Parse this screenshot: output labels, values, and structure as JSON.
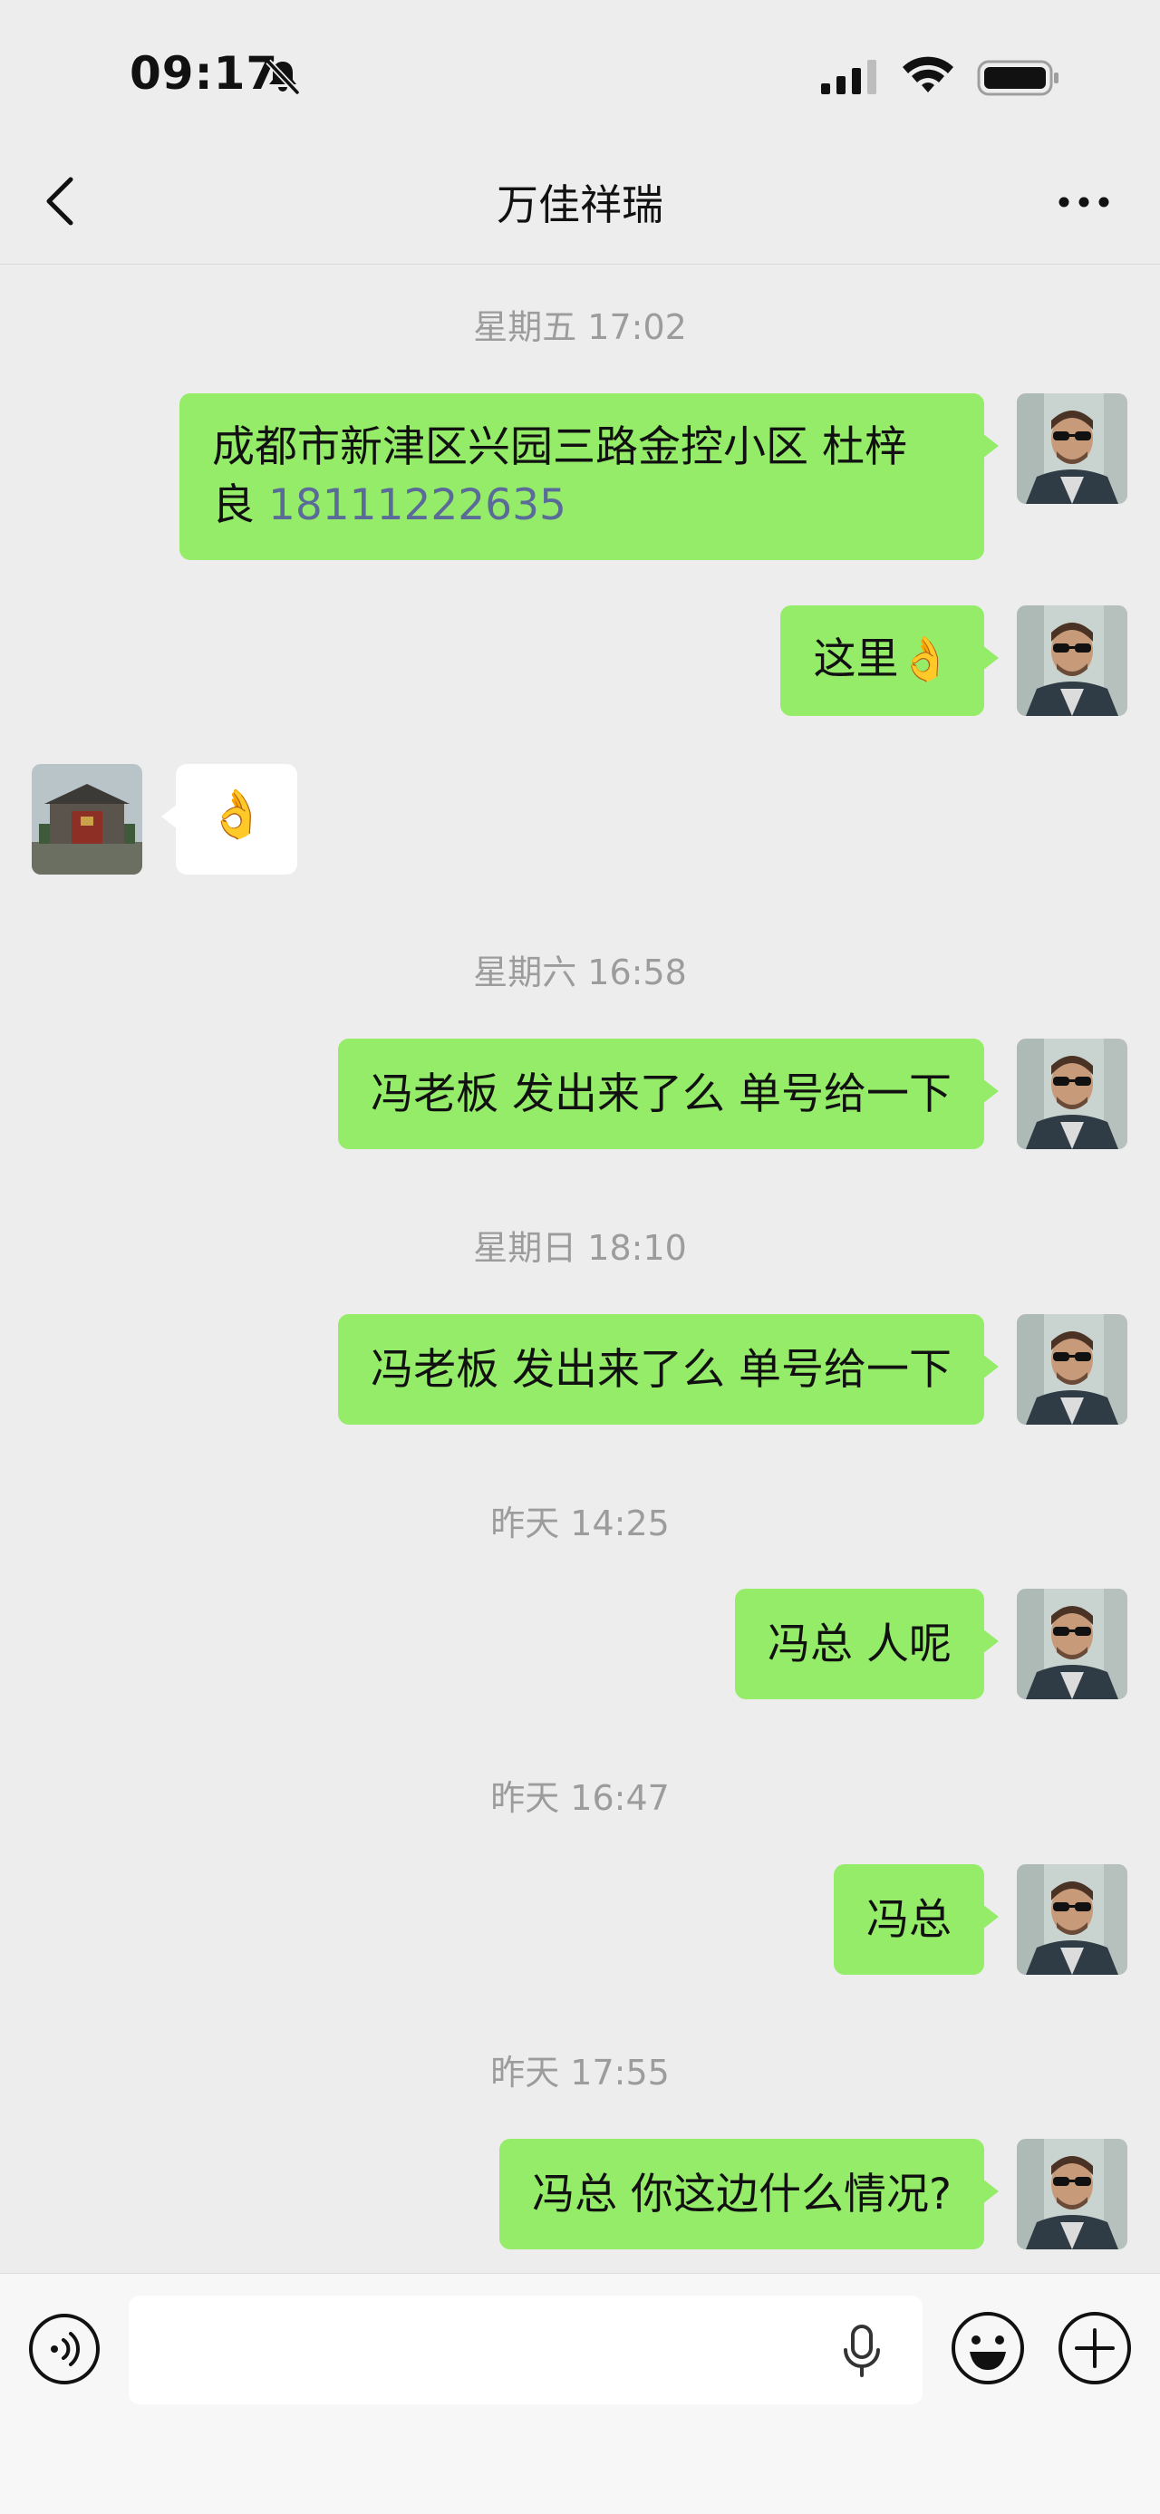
{
  "status_bar": {
    "time": "09:17"
  },
  "nav": {
    "title": "万佳祥瑞"
  },
  "timestamps": [
    "星期五 17:02",
    "星期六 16:58",
    "星期日 18:10",
    "昨天 14:25",
    "昨天 16:47",
    "昨天 17:55"
  ],
  "messages": [
    {
      "sender": "me",
      "text": "成都市新津区兴园三路金控小区 杜梓",
      "text_line2": "良 ",
      "phone": "18111222635"
    },
    {
      "sender": "me",
      "text": "这里",
      "emoji": "👌"
    },
    {
      "sender": "other",
      "emoji": "👌"
    },
    {
      "sender": "me",
      "text": "冯老板 发出来了么 单号给一下"
    },
    {
      "sender": "me",
      "text": "冯老板 发出来了么 单号给一下"
    },
    {
      "sender": "me",
      "text": "冯总 人呢"
    },
    {
      "sender": "me",
      "text": "冯总"
    },
    {
      "sender": "me",
      "text": "冯总 你这边什么情况?"
    }
  ],
  "input": {
    "placeholder": ""
  },
  "colors": {
    "sent_bubble": "#95ec69",
    "received_bubble": "#ffffff",
    "background": "#ededed"
  }
}
